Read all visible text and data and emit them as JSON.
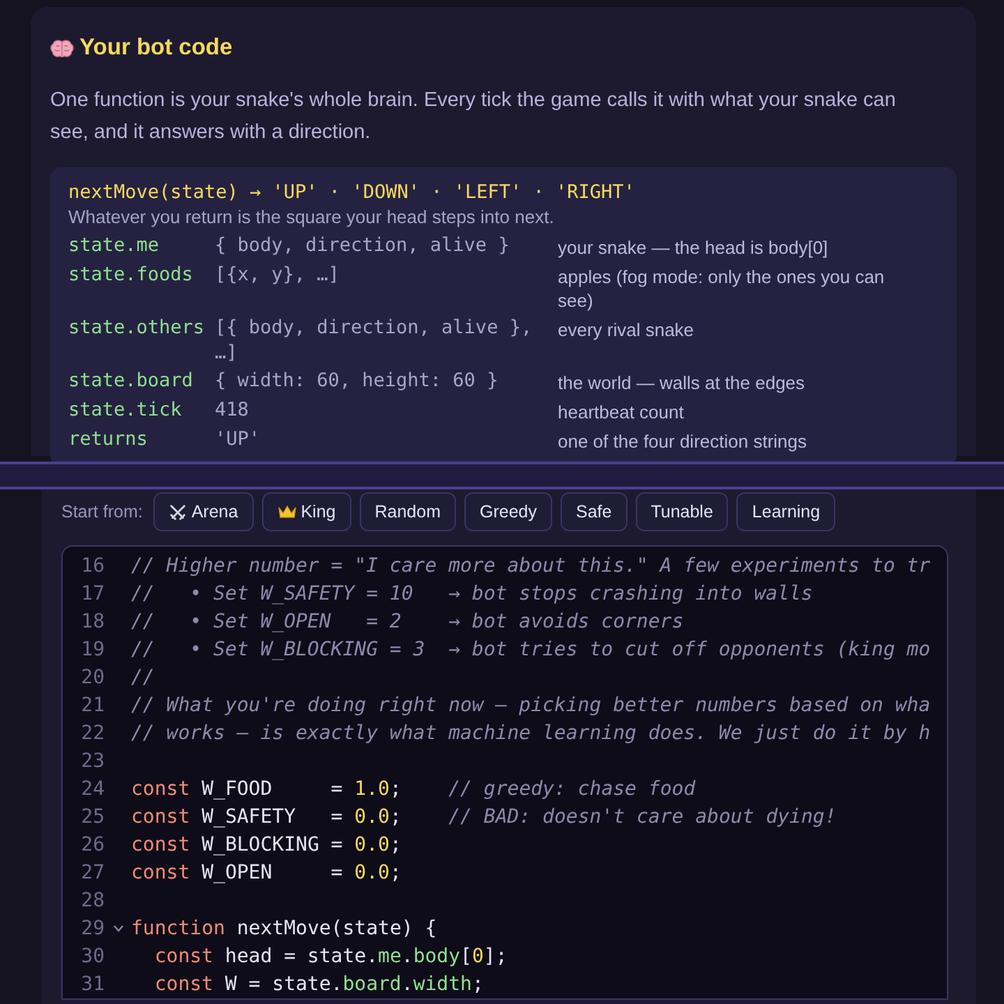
{
  "card": {
    "title": "Your bot code",
    "intro": "One function is your snake's whole brain. Every tick the game calls it with what your snake can see, and it answers with a direction.",
    "signature": "nextMove(state) → 'UP' · 'DOWN' · 'LEFT' · 'RIGHT'",
    "signature_note": "Whatever you return is the square your head steps into next.",
    "fields": [
      {
        "name": "state.me",
        "type": "{ body, direction, alive }",
        "description": "your snake — the head is body[0]"
      },
      {
        "name": "state.foods",
        "type": "[{x, y}, …]",
        "description": "apples (fog mode: only the ones you can see)"
      },
      {
        "name": "state.others",
        "type": "[{ body, direction, alive }, …]",
        "description": "every rival snake"
      },
      {
        "name": "state.board",
        "type": "{ width: 60, height: 60 }",
        "description": "the world — walls at the edges"
      },
      {
        "name": "state.tick",
        "type": "418",
        "description": "heartbeat count"
      },
      {
        "name": "returns",
        "type": "'UP'",
        "description": "one of the four direction strings"
      }
    ]
  },
  "starters": {
    "label": "Start from:",
    "buttons": [
      {
        "label": "Arena",
        "kind": "swords"
      },
      {
        "label": "King",
        "kind": "crown"
      },
      {
        "label": "Random",
        "kind": "text"
      },
      {
        "label": "Greedy",
        "kind": "text"
      },
      {
        "label": "Safe",
        "kind": "text"
      },
      {
        "label": "Tunable",
        "kind": "text"
      },
      {
        "label": "Learning",
        "kind": "text"
      }
    ]
  },
  "editor": {
    "lines": [
      {
        "number": "16",
        "foldable": false,
        "tokens": [
          {
            "kind": "comment",
            "text": "// Higher number = \"I care more about this.\" A few experiments to tr"
          }
        ]
      },
      {
        "number": "17",
        "foldable": false,
        "tokens": [
          {
            "kind": "comment",
            "text": "//   • Set W_SAFETY = 10   → bot stops crashing into walls"
          }
        ]
      },
      {
        "number": "18",
        "foldable": false,
        "tokens": [
          {
            "kind": "comment",
            "text": "//   • Set W_OPEN   = 2    → bot avoids corners"
          }
        ]
      },
      {
        "number": "19",
        "foldable": false,
        "tokens": [
          {
            "kind": "comment",
            "text": "//   • Set W_BLOCKING = 3  → bot tries to cut off opponents (king mo"
          }
        ]
      },
      {
        "number": "20",
        "foldable": false,
        "tokens": [
          {
            "kind": "comment",
            "text": "//"
          }
        ]
      },
      {
        "number": "21",
        "foldable": false,
        "tokens": [
          {
            "kind": "comment",
            "text": "// What you're doing right now — picking better numbers based on wha"
          }
        ]
      },
      {
        "number": "22",
        "foldable": false,
        "tokens": [
          {
            "kind": "comment",
            "text": "// works — is exactly what machine learning does. We just do it by h"
          }
        ]
      },
      {
        "number": "23",
        "foldable": false
      },
      {
        "number": "24",
        "foldable": false,
        "tokens": [
          {
            "kind": "keyword",
            "text": "const"
          },
          {
            "kind": "plain",
            "text": " W_FOOD     = "
          },
          {
            "kind": "number",
            "text": "1.0"
          },
          {
            "kind": "plain",
            "text": ";    "
          },
          {
            "kind": "comment",
            "text": "// greedy: chase food"
          }
        ]
      },
      {
        "number": "25",
        "foldable": false,
        "tokens": [
          {
            "kind": "keyword",
            "text": "const"
          },
          {
            "kind": "plain",
            "text": " W_SAFETY   = "
          },
          {
            "kind": "number",
            "text": "0.0"
          },
          {
            "kind": "plain",
            "text": ";    "
          },
          {
            "kind": "comment",
            "text": "// BAD: doesn't care about dying!"
          }
        ]
      },
      {
        "number": "26",
        "foldable": false,
        "tokens": [
          {
            "kind": "keyword",
            "text": "const"
          },
          {
            "kind": "plain",
            "text": " W_BLOCKING = "
          },
          {
            "kind": "number",
            "text": "0.0"
          },
          {
            "kind": "plain",
            "text": ";"
          }
        ]
      },
      {
        "number": "27",
        "foldable": false,
        "tokens": [
          {
            "kind": "keyword",
            "text": "const"
          },
          {
            "kind": "plain",
            "text": " W_OPEN     = "
          },
          {
            "kind": "number",
            "text": "0.0"
          },
          {
            "kind": "plain",
            "text": ";"
          }
        ]
      },
      {
        "number": "28",
        "foldable": false
      },
      {
        "number": "29",
        "foldable": true,
        "tokens": [
          {
            "kind": "keyword",
            "text": "function"
          },
          {
            "kind": "plain",
            "text": " nextMove(state) {"
          }
        ]
      },
      {
        "number": "30",
        "foldable": false,
        "kind": "nested",
        "tokens": [
          {
            "kind": "keyword",
            "text": "const"
          },
          {
            "kind": "plain",
            "text": " head = state."
          },
          {
            "kind": "property",
            "text": "me"
          },
          {
            "kind": "plain",
            "text": "."
          },
          {
            "kind": "property",
            "text": "body"
          },
          {
            "kind": "plain",
            "text": "["
          },
          {
            "kind": "number",
            "text": "0"
          },
          {
            "kind": "plain",
            "text": "];"
          }
        ]
      },
      {
        "number": "31",
        "foldable": false,
        "kind": "nested",
        "tokens": [
          {
            "kind": "keyword",
            "text": "const"
          },
          {
            "kind": "plain",
            "text": " W = state."
          },
          {
            "kind": "property",
            "text": "board"
          },
          {
            "kind": "plain",
            "text": "."
          },
          {
            "kind": "property",
            "text": "width"
          },
          {
            "kind": "plain",
            "text": ";"
          }
        ]
      }
    ]
  }
}
